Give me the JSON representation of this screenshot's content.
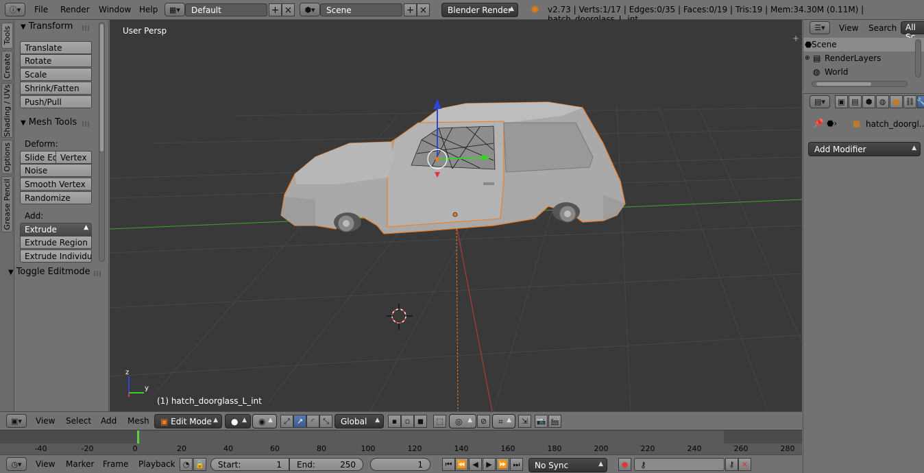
{
  "colors": {
    "accent": "#5680c2",
    "selection": "#f47a1a",
    "viewport_bg": "#393939",
    "grid": "#4a4a4a",
    "x_axis": "#c23b3b",
    "y_axis": "#3fa52a"
  },
  "topbar": {
    "menus": [
      "File",
      "Render",
      "Window",
      "Help"
    ],
    "screen_layout": "Default",
    "scene": "Scene",
    "render_engine": "Blender Render",
    "stats": "v2.73 | Verts:1/17 | Edges:0/35 | Faces:0/19 | Tris:19 | Mem:34.30M (0.11M) | hatch_doorglass_L_int"
  },
  "shelf": {
    "tabs": [
      "Tools",
      "Create",
      "Shading / UVs",
      "Options",
      "Grease Pencil"
    ],
    "transform": {
      "title": "Transform",
      "buttons": [
        "Translate",
        "Rotate",
        "Scale",
        "Shrink/Fatten",
        "Push/Pull"
      ]
    },
    "mesh_tools": {
      "title": "Mesh Tools",
      "deform_label": "Deform:",
      "slide_edge": "Slide Ed",
      "vertex": "Vertex",
      "noise": "Noise",
      "smooth_vertex": "Smooth Vertex",
      "randomize": "Randomize",
      "add_label": "Add:",
      "extrude": "Extrude",
      "extrude_region": "Extrude Region",
      "extrude_individual": "Extrude Individual"
    },
    "toggle_editmode": "Toggle Editmode"
  },
  "viewport": {
    "view_name": "User Persp",
    "object_info": "(1) hatch_doorglass_L_int",
    "axis_y": "y",
    "axis_z": "z"
  },
  "view3d_header": {
    "menus": [
      "View",
      "Select",
      "Add",
      "Mesh"
    ],
    "mode": "Edit Mode",
    "orientation": "Global"
  },
  "timeline": {
    "ticks": [
      "-40",
      "-20",
      "0",
      "20",
      "40",
      "60",
      "80",
      "100",
      "120",
      "140",
      "160",
      "180",
      "200",
      "220",
      "240",
      "260",
      "280"
    ],
    "current_frame_value": 1,
    "menus": [
      "View",
      "Marker",
      "Frame",
      "Playback"
    ],
    "start_label": "Start:",
    "start_value": "1",
    "end_label": "End:",
    "end_value": "250",
    "current_frame": "1",
    "sync": "No Sync"
  },
  "outliner": {
    "menus": [
      "View",
      "Search"
    ],
    "filter": "All Sc",
    "items": [
      "Scene",
      "RenderLayers",
      "World"
    ]
  },
  "properties": {
    "object_name": "hatch_doorgl...",
    "add_modifier": "Add Modifier"
  }
}
